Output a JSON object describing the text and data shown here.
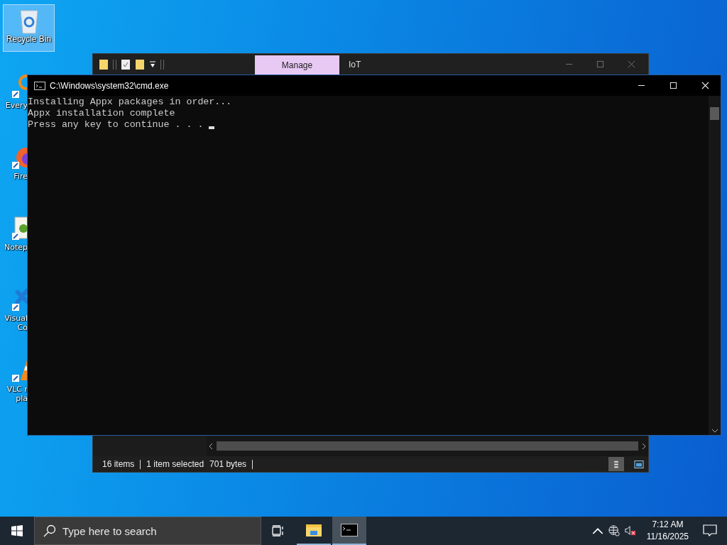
{
  "desktop": {
    "icons": [
      {
        "kind": "recycle",
        "lines": [
          "Recycle Bin"
        ],
        "selected": true
      },
      {
        "kind": "search",
        "lines": [
          "Every"
        ],
        "selected": false
      },
      {
        "kind": "browser",
        "lines": [
          "Fire"
        ],
        "selected": false
      },
      {
        "kind": "notepad",
        "lines": [
          "Notep"
        ],
        "selected": false
      },
      {
        "kind": "code",
        "lines": [
          "Visual",
          "Co"
        ],
        "selected": false
      },
      {
        "kind": "cone",
        "lines": [
          "VLC r",
          "pla"
        ],
        "selected": false
      }
    ]
  },
  "explorer": {
    "ribbon_tabs": [
      {
        "label": "Manage",
        "highlighted": true
      },
      {
        "label": "IoT",
        "highlighted": false
      }
    ],
    "status_bar": {
      "count": "16 items",
      "selection": "1 item selected",
      "size": "701 bytes"
    },
    "view_buttons": [
      {
        "kind": "details",
        "selected": true
      },
      {
        "kind": "large",
        "selected": false
      }
    ]
  },
  "cmd": {
    "title": "C:\\Windows\\system32\\cmd.exe",
    "lines": [
      "Installing Appx packages in order...",
      "Appx installation complete",
      "Press any key to continue . . . "
    ],
    "cursor": true
  },
  "taskbar": {
    "search": {
      "placeholder": "Type here to search"
    },
    "apps": [
      {
        "kind": "explorer",
        "selected": false
      },
      {
        "kind": "terminal",
        "selected": true
      }
    ],
    "clock": {
      "time": "7:12 AM",
      "date": "11/16/2025"
    }
  }
}
